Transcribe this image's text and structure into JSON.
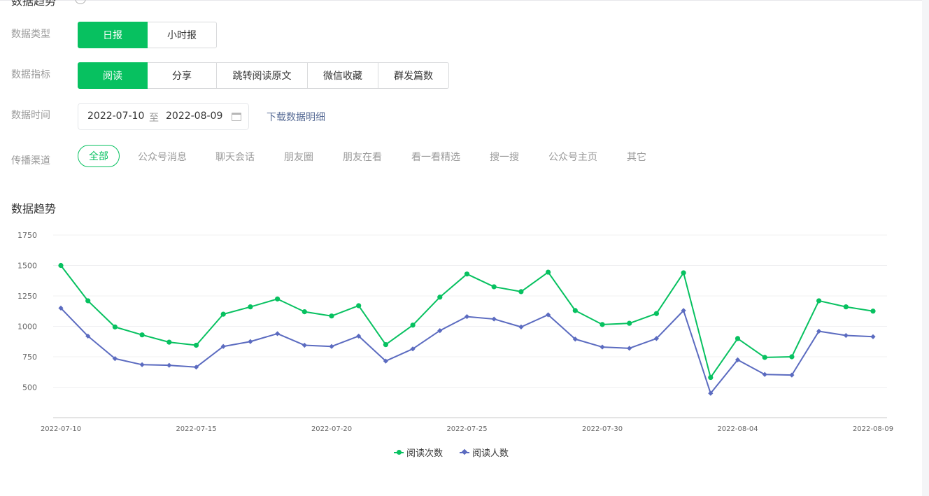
{
  "header": {
    "title": "数据趋势"
  },
  "filters": {
    "type": {
      "label": "数据类型",
      "options": [
        "日报",
        "小时报"
      ],
      "selected": 0
    },
    "metric": {
      "label": "数据指标",
      "options": [
        "阅读",
        "分享",
        "跳转阅读原文",
        "微信收藏",
        "群发篇数"
      ],
      "selected": 0
    },
    "time": {
      "label": "数据时间",
      "start": "2022-07-10",
      "sep": "至",
      "end": "2022-08-09",
      "download": "下载数据明细"
    },
    "channel": {
      "label": "传播渠道",
      "options": [
        "全部",
        "公众号消息",
        "聊天会话",
        "朋友圈",
        "朋友在看",
        "看一看精选",
        "搜一搜",
        "公众号主页",
        "其它"
      ],
      "selected": 0
    }
  },
  "colors": {
    "accent": "#07c160",
    "series1": "#07c160",
    "series2": "#5b6bc0",
    "link": "#576b95"
  },
  "chart_data": {
    "type": "line",
    "title": "数据趋势",
    "x": [
      "2022-07-10",
      "2022-07-11",
      "2022-07-12",
      "2022-07-13",
      "2022-07-14",
      "2022-07-15",
      "2022-07-16",
      "2022-07-17",
      "2022-07-18",
      "2022-07-19",
      "2022-07-20",
      "2022-07-21",
      "2022-07-22",
      "2022-07-23",
      "2022-07-24",
      "2022-07-25",
      "2022-07-26",
      "2022-07-27",
      "2022-07-28",
      "2022-07-29",
      "2022-07-30",
      "2022-07-31",
      "2022-08-01",
      "2022-08-02",
      "2022-08-03",
      "2022-08-04",
      "2022-08-05",
      "2022-08-06",
      "2022-08-07",
      "2022-08-08",
      "2022-08-09"
    ],
    "x_tick_labels": [
      "2022-07-10",
      "2022-07-15",
      "2022-07-20",
      "2022-07-25",
      "2022-07-30",
      "2022-08-04",
      "2022-08-09"
    ],
    "y_ticks": [
      500,
      750,
      1000,
      1250,
      1500,
      1750
    ],
    "ylim": [
      250,
      1750
    ],
    "grid": true,
    "legend_position": "bottom",
    "series": [
      {
        "name": "阅读次数",
        "marker": "circle",
        "values": [
          1500,
          1210,
          995,
          930,
          870,
          845,
          1100,
          1160,
          1225,
          1120,
          1085,
          1170,
          850,
          1010,
          1240,
          1430,
          1325,
          1285,
          1445,
          1130,
          1015,
          1025,
          1105,
          1440,
          580,
          900,
          745,
          750,
          1210,
          1160,
          1125
        ]
      },
      {
        "name": "阅读人数",
        "marker": "diamond",
        "values": [
          1150,
          920,
          735,
          685,
          680,
          665,
          835,
          875,
          940,
          845,
          835,
          920,
          715,
          815,
          965,
          1080,
          1060,
          995,
          1095,
          895,
          830,
          820,
          900,
          1130,
          450,
          725,
          605,
          600,
          960,
          925,
          915
        ]
      }
    ]
  }
}
